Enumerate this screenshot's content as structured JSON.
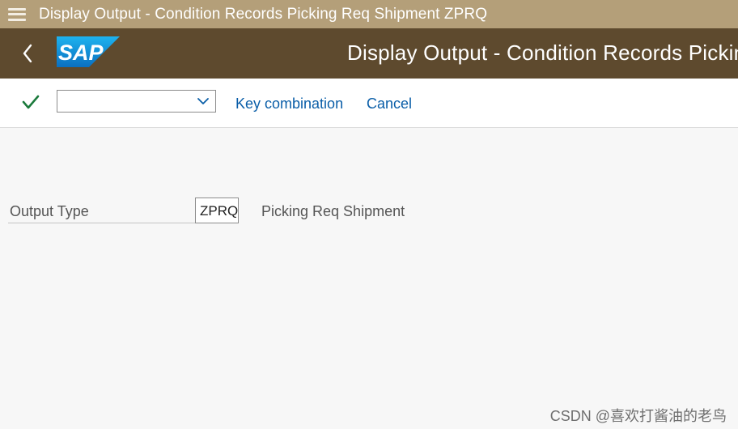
{
  "window": {
    "title": "Display Output - Condition Records Picking Req Shipment ZPRQ"
  },
  "shell": {
    "logo_text": "SAP",
    "title": "Display Output - Condition Records Picking Req Shipment ZPRQ",
    "colors": {
      "titlebar": "#b49f79",
      "header": "#5e4a2e"
    }
  },
  "toolbar": {
    "enter_icon": "checkmark-icon",
    "select_value": "",
    "key_combination_label": "Key combination",
    "cancel_label": "Cancel",
    "link_color": "#0a5ea8"
  },
  "form": {
    "output_type_label": "Output Type",
    "output_type_value": "ZPRQ",
    "output_type_description": "Picking Req Shipment"
  },
  "watermark": "CSDN @喜欢打酱油的老鸟"
}
